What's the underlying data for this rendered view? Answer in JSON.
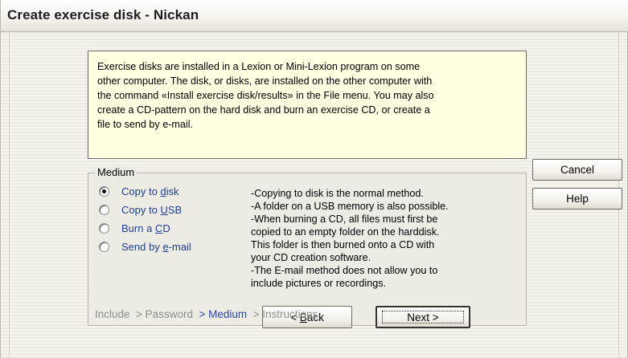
{
  "window": {
    "title": "Create exercise disk - Nickan"
  },
  "info": {
    "lines": [
      "Exercise disks are installed in a Lexion or Mini-Lexion program on some",
      "other computer. The disk, or disks, are installed on the other computer with",
      "the command «Install exercise disk/results» in the File menu. You may also",
      "create a CD-pattern on the hard disk and burn an exercise CD, or create a",
      "file to send by e-mail."
    ]
  },
  "medium": {
    "group_label": "Medium",
    "options": [
      {
        "pre": "Copy to ",
        "acc": "d",
        "post": "isk",
        "checked": true
      },
      {
        "pre": "Copy to ",
        "acc": "U",
        "post": "SB",
        "checked": false
      },
      {
        "pre": "Burn a ",
        "acc": "C",
        "post": "D",
        "checked": false
      },
      {
        "pre": "Send by ",
        "acc": "e",
        "post": "-mail",
        "checked": false
      }
    ],
    "description": [
      "-Copying to disk is the normal method.",
      "-A folder on a USB memory is also possible.",
      "-When burning a CD, all files must first be",
      "copied to an empty folder on the harddisk.",
      "This folder is then burned onto a CD with",
      "your CD creation software.",
      "-The E-mail method does not allow you to",
      "include pictures or recordings."
    ]
  },
  "buttons": {
    "cancel": "Cancel",
    "help": "Help",
    "back_pre": "< ",
    "back_acc": "B",
    "back_post": "ack",
    "next": "Next >"
  },
  "breadcrumb": {
    "include": "Include",
    "password": "  > Password",
    "medium": "  > Medium",
    "instructions": "  > Instructions"
  }
}
